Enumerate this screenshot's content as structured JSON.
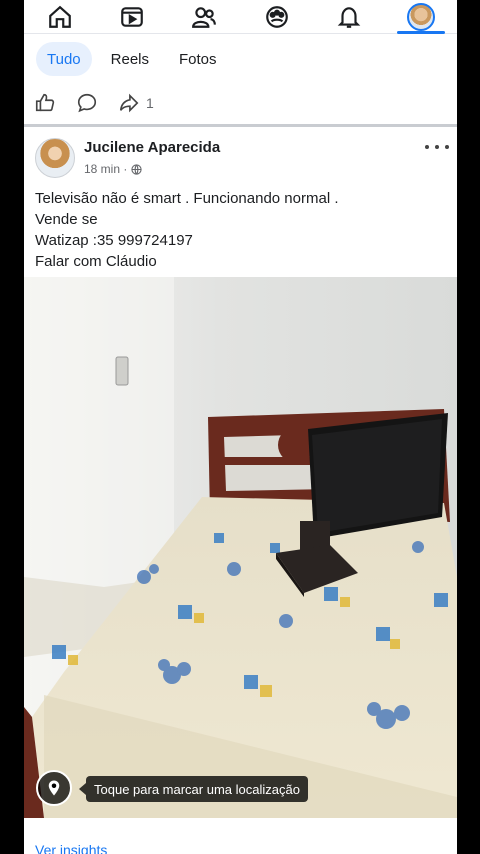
{
  "nav": {
    "items": [
      {
        "name": "home-icon"
      },
      {
        "name": "video-icon"
      },
      {
        "name": "friends-icon"
      },
      {
        "name": "groups-icon"
      },
      {
        "name": "notifications-icon"
      },
      {
        "name": "profile-avatar"
      }
    ],
    "active": "profile-avatar",
    "accent": "#1877f2"
  },
  "tabs": [
    "Tudo",
    "Reels",
    "Fotos"
  ],
  "actions": {
    "share_count": "1"
  },
  "post": {
    "author": "Jucilene Aparecida",
    "time": "18 min ·",
    "lines": [
      "Televisão não é smart . Funcionando normal .",
      "Vende se",
      "Watizap :35 999724197",
      "Falar com Cláudio"
    ],
    "location_hint": "Toque para marcar uma localização",
    "insights_link": "Ver insights"
  }
}
